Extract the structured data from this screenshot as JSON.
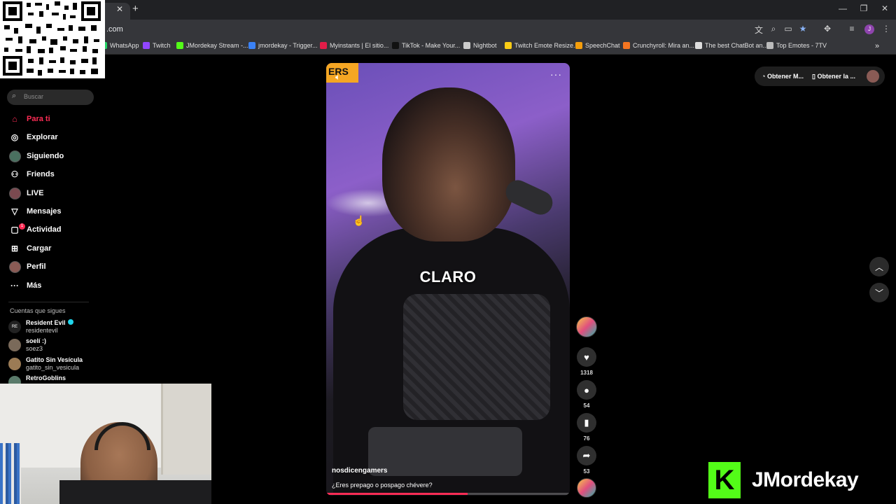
{
  "browser": {
    "url_suffix": ".com",
    "bookmarks": [
      {
        "label": "WhatsApp",
        "color": "#25d366"
      },
      {
        "label": "Twitch",
        "color": "#9146ff"
      },
      {
        "label": "JMordekay Stream -...",
        "color": "#53fc18"
      },
      {
        "label": "jmordekay - Trigger...",
        "color": "#3b82f6"
      },
      {
        "label": "Myinstants | El sitio...",
        "color": "#e11d48"
      },
      {
        "label": "TikTok - Make Your...",
        "color": "#111111"
      },
      {
        "label": "Nightbot",
        "color": "#cccccc"
      },
      {
        "label": "Twitch Emote Resize...",
        "color": "#facc15"
      },
      {
        "label": "SpeechChat",
        "color": "#f59e0b"
      },
      {
        "label": "Crunchyroll: Mira an...",
        "color": "#f47521"
      },
      {
        "label": "The best ChatBot an...",
        "color": "#dddddd"
      },
      {
        "label": "Top Emotes - 7TV",
        "color": "#bbbbbb"
      }
    ]
  },
  "sidebar": {
    "search_placeholder": "Buscar",
    "nav": [
      {
        "label": "Para ti",
        "icon": "home-icon",
        "glyph": "⌂"
      },
      {
        "label": "Explorar",
        "icon": "compass-icon",
        "glyph": "◎"
      },
      {
        "label": "Siguiendo",
        "icon": "following-avatar-icon",
        "glyph": ""
      },
      {
        "label": "Friends",
        "icon": "friends-icon",
        "glyph": "⚇"
      },
      {
        "label": "LIVE",
        "icon": "live-avatar-icon",
        "glyph": ""
      },
      {
        "label": "Mensajes",
        "icon": "send-icon",
        "glyph": "▽"
      },
      {
        "label": "Actividad",
        "icon": "inbox-icon",
        "glyph": "▢"
      },
      {
        "label": "Cargar",
        "icon": "upload-icon",
        "glyph": "⊞"
      },
      {
        "label": "Perfil",
        "icon": "profile-avatar-icon",
        "glyph": ""
      },
      {
        "label": "Más",
        "icon": "more-icon",
        "glyph": "···"
      }
    ],
    "activity_badge": "1",
    "following_title": "Cuentas que sigues",
    "accounts": [
      {
        "name": "Resident Evil",
        "user": "residentevil",
        "verified": true,
        "color": "#222222"
      },
      {
        "name": "soelí :)",
        "user": "soez3",
        "verified": false,
        "color": "#7a6a5a"
      },
      {
        "name": "Gatito Sin Vesícula",
        "user": "gatito_sin_vesicula",
        "verified": false,
        "color": "#9b7b55"
      },
      {
        "name": "RetroGoblins",
        "user": "",
        "verified": false,
        "color": "#5a7a6a"
      }
    ]
  },
  "video": {
    "logo_text": "ERS",
    "caption": "CLARO",
    "username": "nosdicengamers",
    "description": "¿Eres prepago o pospago chévere?",
    "progress": 0.58
  },
  "actions": {
    "likes": "1318",
    "comments": "54",
    "saves": "76",
    "shares": "53"
  },
  "topright": {
    "get_app": "Obtener M...",
    "get_desktop": "Obtener la ..."
  },
  "brand": {
    "letter": "K",
    "name": "JMordekay",
    "color": "#53fc18"
  }
}
